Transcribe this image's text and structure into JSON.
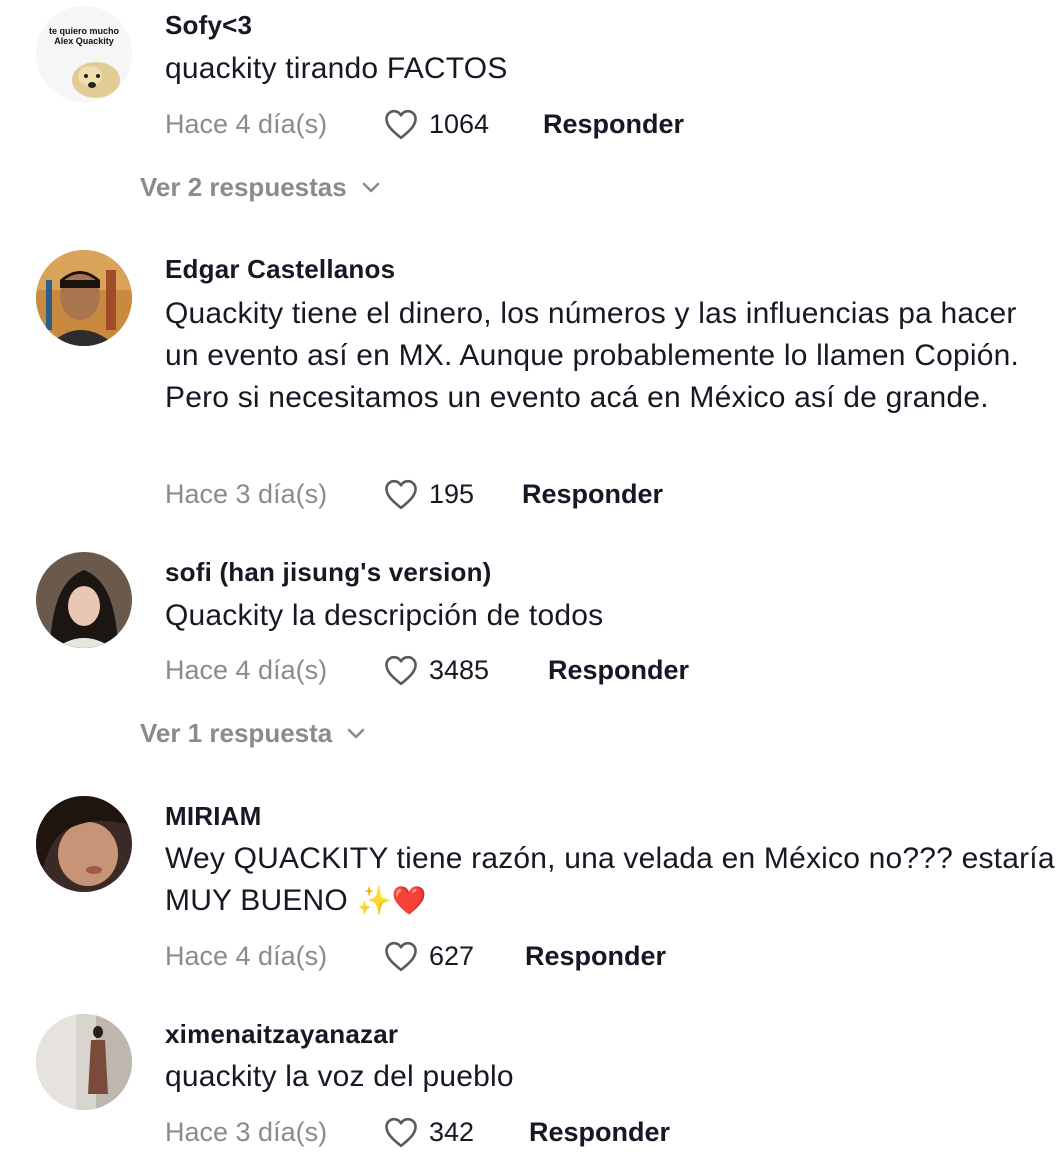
{
  "comments": [
    {
      "username": "Sofy<3",
      "avatar_caption": "te quiero mucho Alex Quackity",
      "text": "quackity tirando FACTOS",
      "date": "Hace 4 día(s)",
      "likes": "1064",
      "reply_label": "Responder",
      "view_replies": "Ver 2 respuestas"
    },
    {
      "username": "Edgar Castellanos",
      "text": "Quackity tiene el dinero, los números y las influencias pa hacer un evento así en MX. Aunque probablemente lo llamen Copión. Pero si necesitamos un evento acá en México así de grande.",
      "date": "Hace 3 día(s)",
      "likes": "195",
      "reply_label": "Responder"
    },
    {
      "username": "sofi (han jisung's version)",
      "text": "Quackity la descripción de todos",
      "date": "Hace 4 día(s)",
      "likes": "3485",
      "reply_label": "Responder",
      "view_replies": "Ver 1 respuesta"
    },
    {
      "username": "MIRIAM",
      "text": "Wey QUACKITY tiene razón, una velada en México no??? estaría MUY BUENO",
      "emoji_sparkles": "✨",
      "emoji_heart": "❤️",
      "date": "Hace 4 día(s)",
      "likes": "627",
      "reply_label": "Responder"
    },
    {
      "username": "ximenaitzayanazar",
      "text": "quackity la voz del pueblo",
      "date": "Hace 3 día(s)",
      "likes": "342",
      "reply_label": "Responder"
    }
  ],
  "icons": {
    "like": "heart-outline-icon",
    "expand": "chevron-down-icon"
  },
  "colors": {
    "primary_text": "#161823",
    "secondary_text": "#8a8b91",
    "background": "#ffffff"
  }
}
